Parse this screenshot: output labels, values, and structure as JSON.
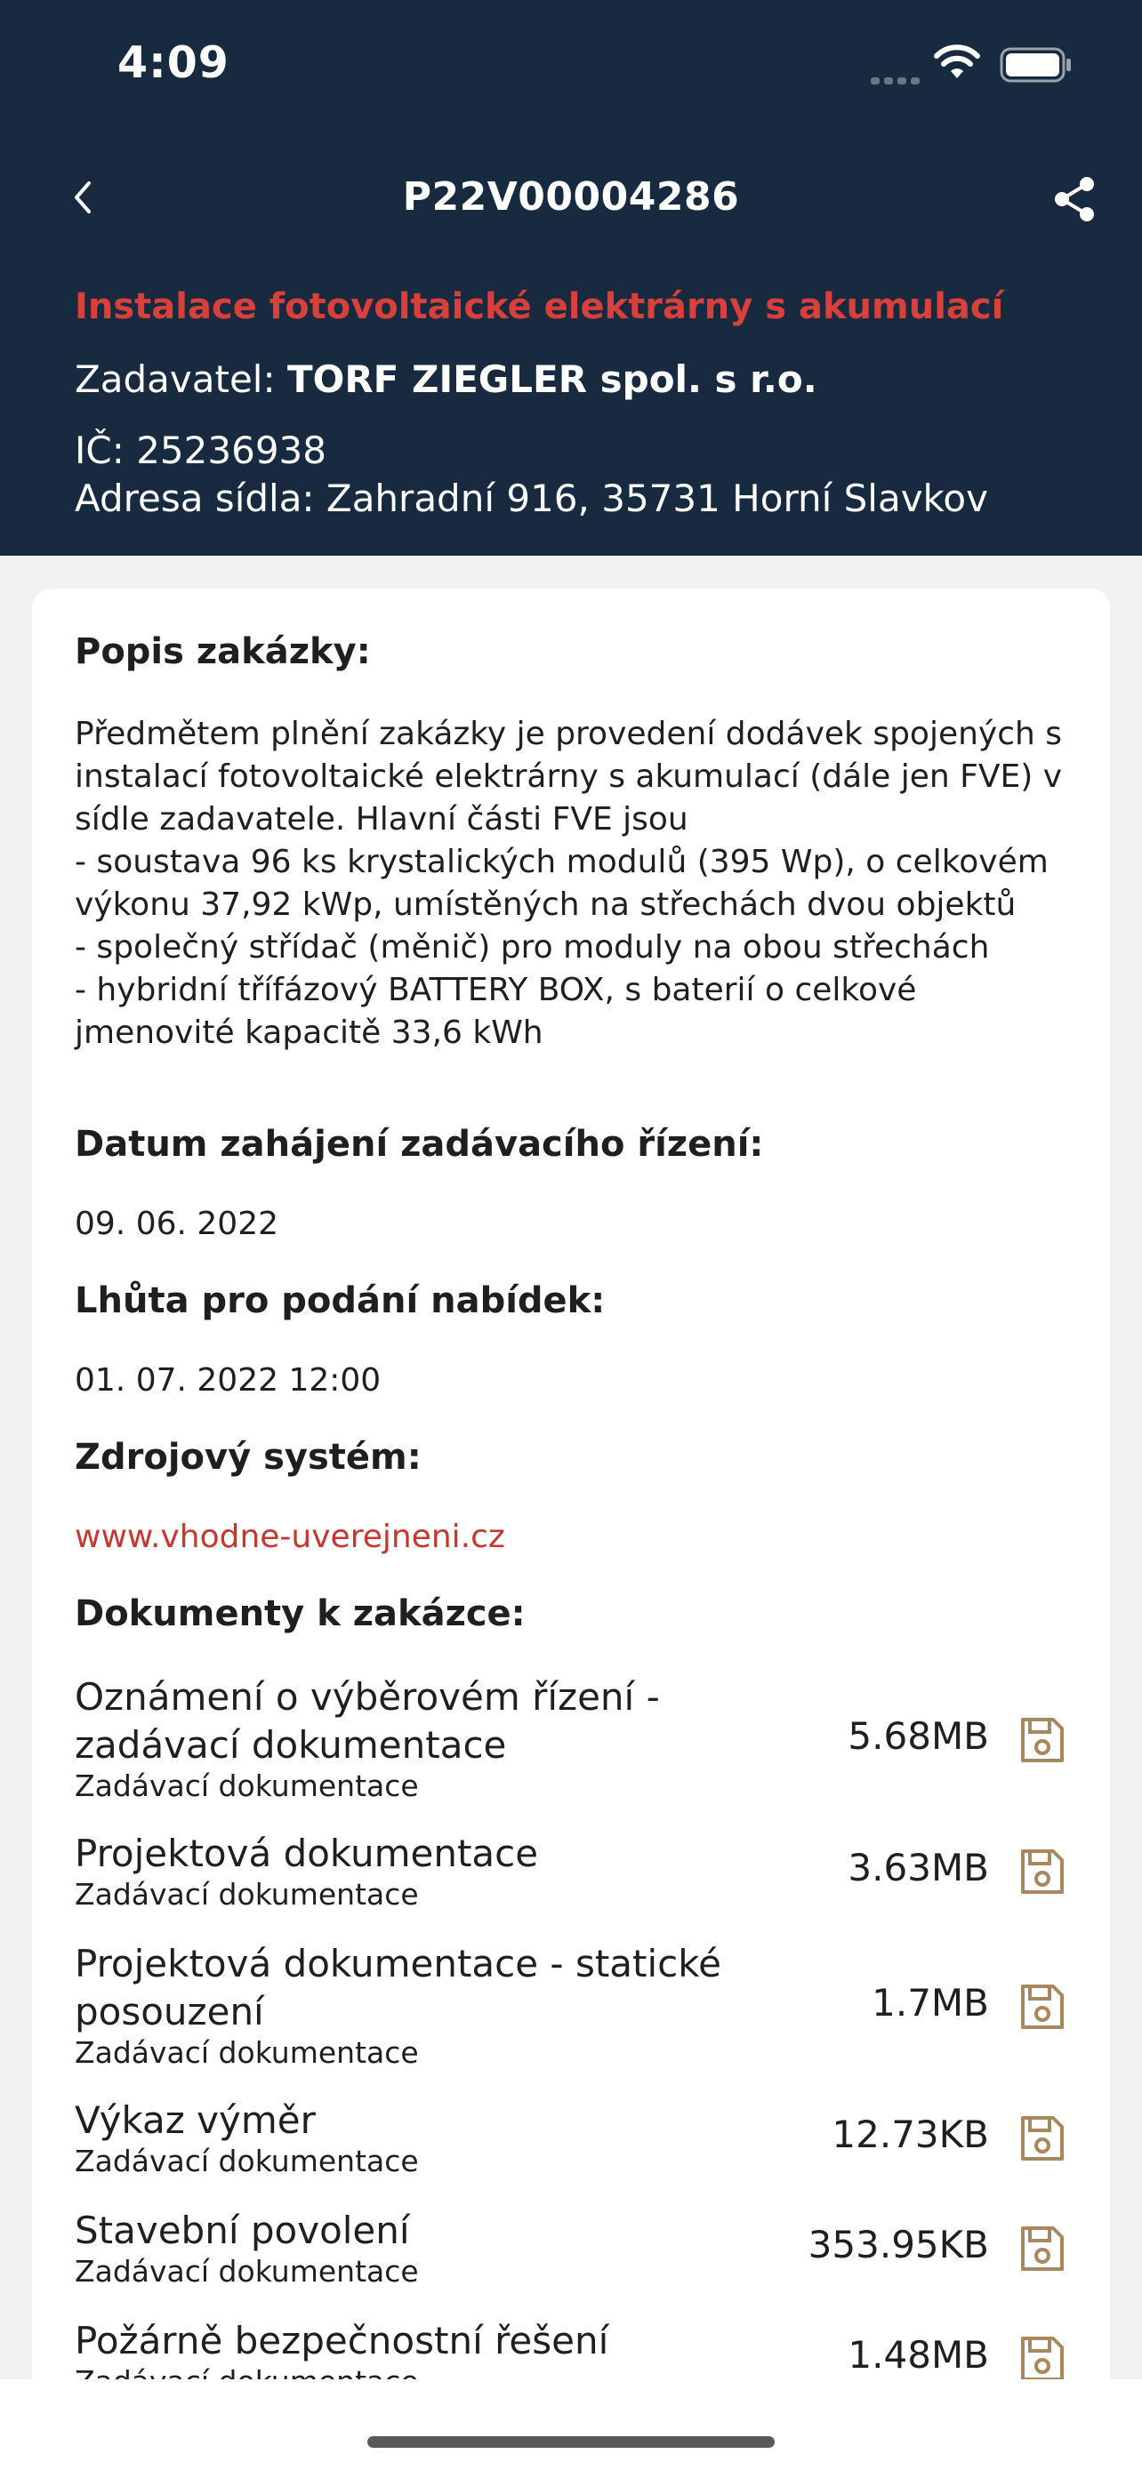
{
  "status": {
    "time": "4:09"
  },
  "nav": {
    "title": "P22V00004286"
  },
  "header": {
    "title": "Instalace fotovoltaické elektrárny s akumulací",
    "zadavatel_label": "Zadavatel: ",
    "zadavatel_value": "TORF ZIEGLER spol. s r.o.",
    "ic": "IČ: 25236938",
    "address": "Adresa sídla: Zahradní 916, 35731 Horní Slavkov"
  },
  "description": {
    "title": "Popis zakázky:",
    "text": "Předmětem plnění zakázky je provedení dodávek spojených s instalací fotovoltaické elektrárny s akumulací (dále jen FVE) v sídle zadavatele. Hlavní části FVE jsou\n- soustava 96 ks krystalických modulů (395 Wp), o celkovém výkonu 37,92 kWp, umístěných na střechách dvou objektů\n- společný střídač (měnič) pro moduly na obou střechách\n- hybridní třífázový BATTERY BOX, s baterií o celkové jmenovité kapacitě 33,6 kWh"
  },
  "start_date": {
    "title": "Datum zahájení zadávacího řízení:",
    "value": "09. 06. 2022"
  },
  "deadline": {
    "title": "Lhůta pro podání nabídek:",
    "value": "01. 07. 2022 12:00"
  },
  "source": {
    "title": "Zdrojový systém:",
    "value": "www.vhodne-uverejneni.cz"
  },
  "documents": {
    "title": "Dokumenty k zakázce:",
    "items": [
      {
        "name": "Oznámení o výběrovém řízení - zadávací dokumentace",
        "type": "Zadávací dokumentace",
        "size": "5.68MB"
      },
      {
        "name": "Projektová dokumentace",
        "type": "Zadávací dokumentace",
        "size": "3.63MB"
      },
      {
        "name": "Projektová dokumentace - statické posouzení",
        "type": "Zadávací dokumentace",
        "size": "1.7MB"
      },
      {
        "name": "Výkaz výměr",
        "type": "Zadávací dokumentace",
        "size": "12.73KB"
      },
      {
        "name": "Stavební povolení",
        "type": "Zadávací dokumentace",
        "size": "353.95KB"
      },
      {
        "name": "Požárně bezpečnostní řešení",
        "type": "Zadávací dokumentace",
        "size": "1.48MB"
      }
    ]
  },
  "colors": {
    "header_bg": "#172a40",
    "accent": "#c7372f",
    "save_icon": "#a8895f"
  },
  "icons": [
    "back-chevron-icon",
    "share-icon",
    "wifi-icon",
    "battery-icon",
    "save-icon"
  ]
}
